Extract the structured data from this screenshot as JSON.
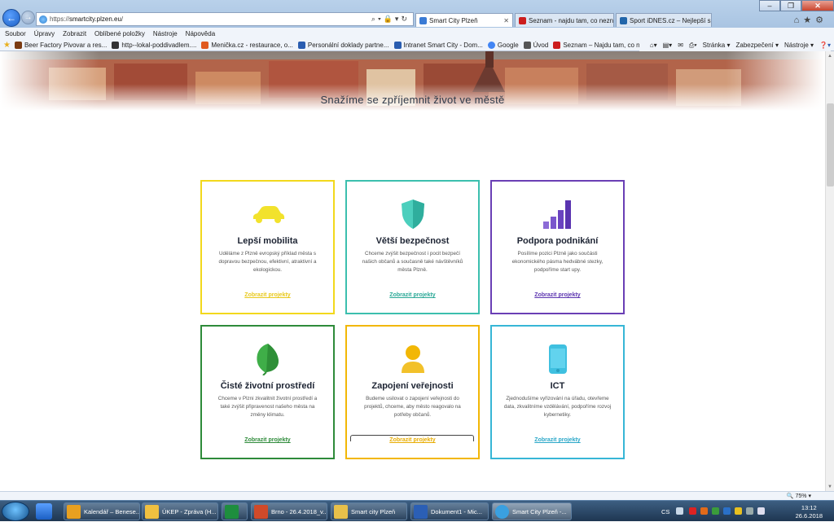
{
  "browser": {
    "url_prefix": "https://",
    "url_host": "smartcity.plzen.eu",
    "url_suffix": "/",
    "tabs": [
      {
        "label": "Smart City Plzeň",
        "active": true
      },
      {
        "label": "Seznam - najdu tam, co neznám"
      },
      {
        "label": "Sport iDNES.cz – Nejlepší sport"
      }
    ],
    "menu": [
      "Soubor",
      "Úpravy",
      "Zobrazit",
      "Oblíbené položky",
      "Nástroje",
      "Nápověda"
    ],
    "favorites": [
      {
        "label": "Beer Factory Pivovar a res...",
        "color": "#7a3b12"
      },
      {
        "label": "http--lokal-poddivadlem....",
        "color": "#333333"
      },
      {
        "label": "Menička.cz - restaurace, o...",
        "color": "#e05a1e"
      },
      {
        "label": "Personální doklady partne...",
        "color": "#2a5db0"
      },
      {
        "label": "Intranet Smart City - Dom...",
        "color": "#2a5db0"
      },
      {
        "label": "Google",
        "color": "#4285f4"
      },
      {
        "label": "Úvod",
        "color": "#555555"
      },
      {
        "label": "Seznam – Najdu tam, co nez...",
        "color": "#cc1d1d"
      }
    ],
    "commands": [
      "Stránka ▾",
      "Zabezpečení ▾",
      "Nástroje ▾"
    ],
    "zoom": "75%"
  },
  "page": {
    "headline": "Snažíme se zpříjemnit život ve městě",
    "cards": [
      {
        "title": "Lepší mobilita",
        "desc": "Uděláme z Plzně evropský příklad města s dopravou bezpečnou, efektivní, atraktivní a ekologickou.",
        "link": "Zobrazit projekty",
        "color": "#f2d81c",
        "icon": "car-icon"
      },
      {
        "title": "Větší bezpečnost",
        "desc": "Chceme zvýšit bezpečnost i pocit bezpečí našich občanů a současně také návštěvníků města Plzně.",
        "link": "Zobrazit projekty",
        "color": "#3cbfae",
        "icon": "shield-icon"
      },
      {
        "title": "Podpora podnikání",
        "desc": "Posílíme pozici Plzně jako součásti ekonomického pásma hedvábné stezky, podpoříme start upy.",
        "link": "Zobrazit projekty",
        "color": "#6a3fb5",
        "icon": "bar-chart-icon"
      },
      {
        "title": "Čisté životní prostředí",
        "desc": "Chceme v Plzni zkvalitnit životní prostředí a také zvýšit připravenost našeho města na změny klimatu.",
        "link": "Zobrazit projekty",
        "color": "#2e8b3a",
        "icon": "leaf-icon"
      },
      {
        "title": "Zapojení veřejnosti",
        "desc": "Budeme usilovat o zapojení veřejnosti do projektů, chceme, aby město reagovalo na potřeby občanů.",
        "link": "Zobrazit projekty",
        "color": "#f2b705",
        "icon": "person-icon"
      },
      {
        "title": "ICT",
        "desc": "Zjednodušíme vyřizování na úřadu, otevřeme data, zkvalitníme vzdělávání, podpoříme rozvoj kybernetiky.",
        "link": "Zobrazit projekty",
        "color": "#37b6d6",
        "icon": "phone-icon"
      }
    ]
  },
  "taskbar": {
    "items": [
      {
        "label": "Kalendář – Benese...",
        "color": "#e8a020"
      },
      {
        "label": "ÚKEP - Zpráva (H...",
        "color": "#f0c040"
      },
      {
        "label": "",
        "color": "#1e8e3e"
      },
      {
        "label": "Brno - 26.4.2018_v...",
        "color": "#d04a2a"
      },
      {
        "label": "Smart city Plzeň",
        "color": "#e8c04a"
      },
      {
        "label": "Dokument1 - Mic...",
        "color": "#2b5fb5"
      },
      {
        "label": "Smart City Plzeň -...",
        "color": "#3aa0e0"
      }
    ],
    "lang": "CS",
    "time": "13:12",
    "date": "26.6.2018"
  }
}
